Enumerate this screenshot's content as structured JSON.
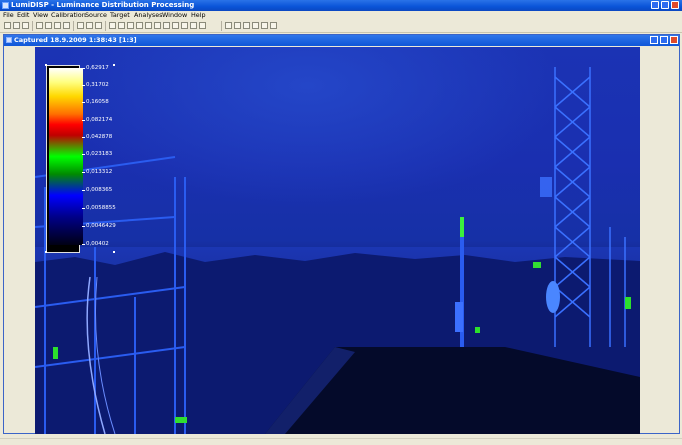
{
  "app": {
    "title": "LumiDISP - Luminance Distribution Processing"
  },
  "menu": [
    "File",
    "Edit",
    "View",
    "Calibration",
    "Source",
    "Target",
    "Analyses",
    "Window",
    "Help"
  ],
  "child_window": {
    "title": "Captured 18.9.2009 1:38:43 [1:3]"
  },
  "legend": {
    "labels": [
      "0,62917",
      "0,31702",
      "0,16058",
      "0,082174",
      "0,042878",
      "0,023183",
      "0,013312",
      "0,008365",
      "0,0058855",
      "0,0046429",
      "0,00402"
    ]
  },
  "colors": {
    "titlebar": "#0a54d8",
    "sky": "#1a2fb0",
    "accent_green": "#3cf03c"
  }
}
